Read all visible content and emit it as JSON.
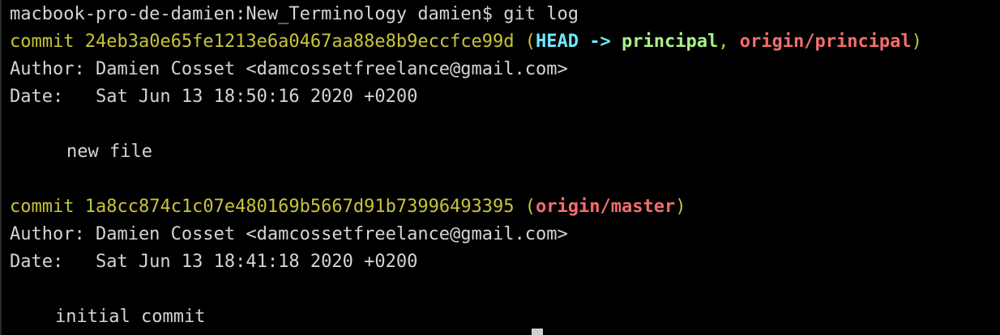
{
  "prompt": {
    "text": "macbook-pro-de-damien:New_Terminology damien$ git log"
  },
  "commits": [
    {
      "label": "commit",
      "hash": "24eb3a0e65fe1213e6a0467aa88e8b9eccfce99d",
      "open_paren": "(",
      "head": "HEAD",
      "arrow": "->",
      "branch": "principal",
      "comma": ",",
      "remote": "origin/principal",
      "close_paren": ")",
      "author": "Author: Damien Cosset <damcossetfreelance@gmail.com>",
      "date": "Date:   Sat Jun 13 18:50:16 2020 +0200",
      "message": "new file"
    },
    {
      "label": "commit",
      "hash": "1a8cc874c1c07e480169b5667d91b73996493395",
      "open_paren": "(",
      "remote": "origin/master",
      "close_paren": ")",
      "author": "Author: Damien Cosset <damcossetfreelance@gmail.com>",
      "date": "Date:   Sat Jun 13 18:41:18 2020 +0200",
      "message": "initial commit"
    }
  ],
  "colors": {
    "background": "#000000",
    "text": "#d4d4d4",
    "commit": "#c7c43a",
    "head": "#6fe8ff",
    "branch": "#a8f08a",
    "remote": "#f26d6d"
  }
}
